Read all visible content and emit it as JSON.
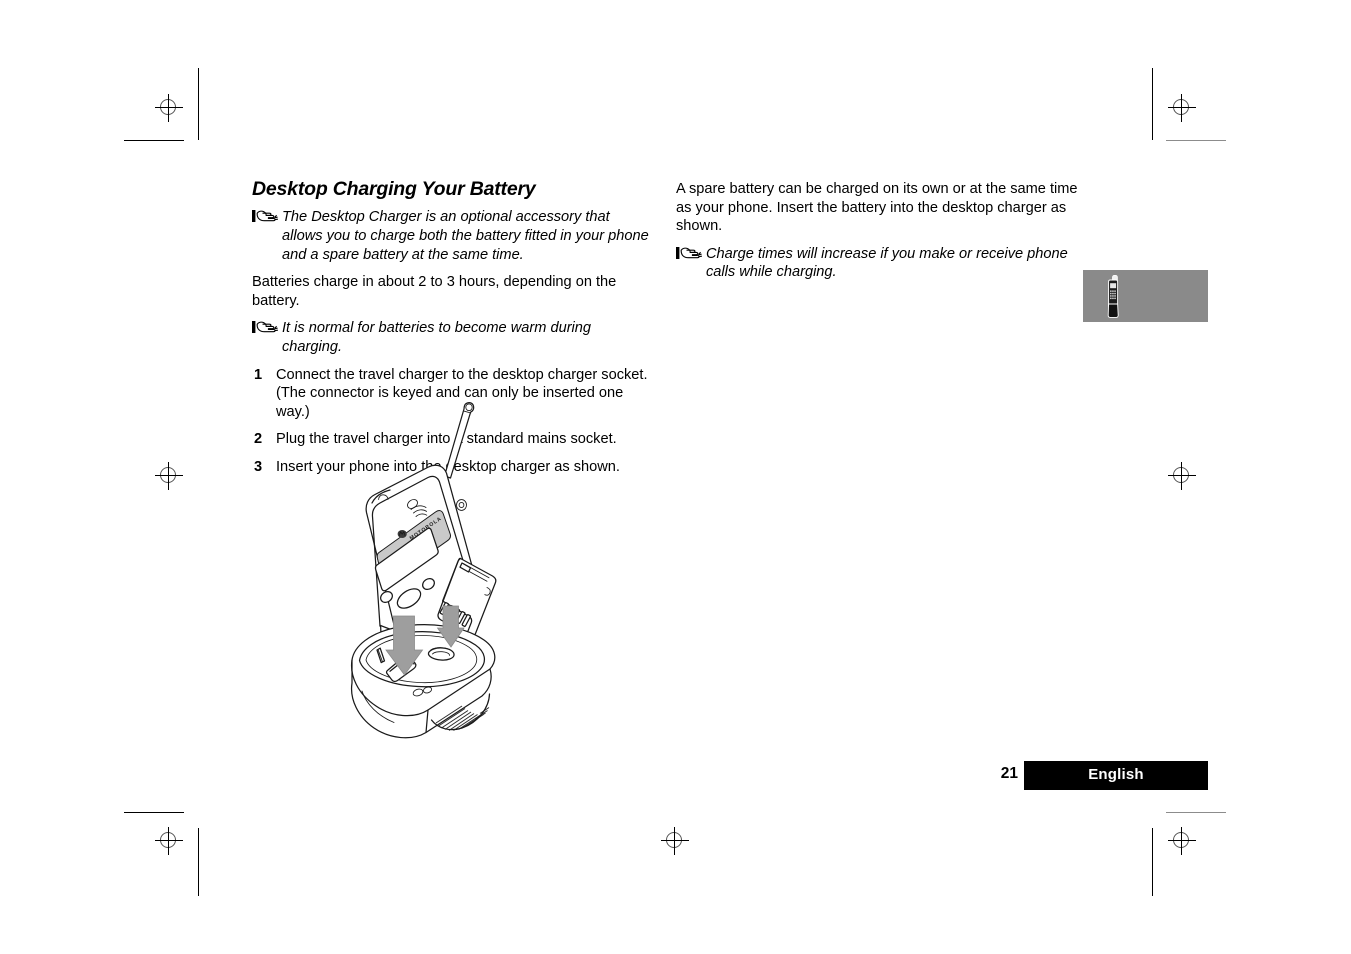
{
  "document": {
    "section_title": "Desktop Charging Your Battery",
    "page_number": "21",
    "language_label": "English"
  },
  "left_column": {
    "note_1": "The Desktop Charger is an optional accessory that allows you to charge both the battery fitted in your phone and a spare battery at the same time.",
    "paragraph_1": "Batteries charge in about 2 to 3 hours, depending on the battery.",
    "note_2": "It is normal for batteries to become warm during charging.",
    "steps": [
      {
        "number": "1",
        "text": "Connect the travel charger to the desktop charger socket. (The connector is keyed and can only be inserted one way.)"
      },
      {
        "number": "2",
        "text": "Plug the travel charger into a standard mains socket."
      },
      {
        "number": "3",
        "text": "Insert your phone into the desktop charger as shown."
      }
    ]
  },
  "right_column": {
    "paragraph_1": "A spare battery can be charged on its own or at the same time as your phone. Insert the battery into the desktop charger as shown.",
    "note_1": "Charge times will increase if you make or receive phone calls while charging."
  },
  "icons": {
    "note_pointer": "pointing-hand-icon",
    "side_tab_phone": "mobile-phone-icon"
  },
  "illustration": {
    "name": "phone-and-desktop-charger-illustration",
    "caption": ""
  },
  "colors": {
    "side_tab_background": "#8a8a8a",
    "footer_bar_background": "#000000",
    "footer_bar_text": "#ffffff",
    "illustration_shading": "#b8b8b8",
    "arrow_fill": "#9e9e9e"
  }
}
